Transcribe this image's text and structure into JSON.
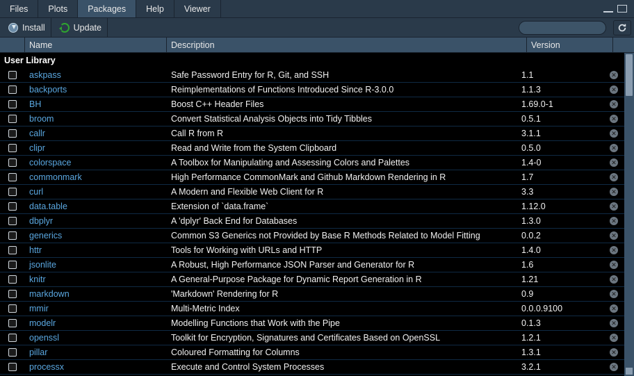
{
  "tabs": [
    {
      "label": "Files",
      "active": false
    },
    {
      "label": "Plots",
      "active": false
    },
    {
      "label": "Packages",
      "active": true
    },
    {
      "label": "Help",
      "active": false
    },
    {
      "label": "Viewer",
      "active": false
    }
  ],
  "toolbar": {
    "install_label": "Install",
    "update_label": "Update",
    "search_placeholder": ""
  },
  "columns": {
    "name": "Name",
    "description": "Description",
    "version": "Version"
  },
  "section_title": "User Library",
  "packages": [
    {
      "name": "askpass",
      "desc": "Safe Password Entry for R, Git, and SSH",
      "version": "1.1"
    },
    {
      "name": "backports",
      "desc": "Reimplementations of Functions Introduced Since R-3.0.0",
      "version": "1.1.3"
    },
    {
      "name": "BH",
      "desc": "Boost C++ Header Files",
      "version": "1.69.0-1"
    },
    {
      "name": "broom",
      "desc": "Convert Statistical Analysis Objects into Tidy Tibbles",
      "version": "0.5.1"
    },
    {
      "name": "callr",
      "desc": "Call R from R",
      "version": "3.1.1"
    },
    {
      "name": "clipr",
      "desc": "Read and Write from the System Clipboard",
      "version": "0.5.0"
    },
    {
      "name": "colorspace",
      "desc": "A Toolbox for Manipulating and Assessing Colors and Palettes",
      "version": "1.4-0"
    },
    {
      "name": "commonmark",
      "desc": "High Performance CommonMark and Github Markdown Rendering in R",
      "version": "1.7"
    },
    {
      "name": "curl",
      "desc": "A Modern and Flexible Web Client for R",
      "version": "3.3"
    },
    {
      "name": "data.table",
      "desc": "Extension of `data.frame`",
      "version": "1.12.0"
    },
    {
      "name": "dbplyr",
      "desc": "A 'dplyr' Back End for Databases",
      "version": "1.3.0"
    },
    {
      "name": "generics",
      "desc": "Common S3 Generics not Provided by Base R Methods Related to Model Fitting",
      "version": "0.0.2"
    },
    {
      "name": "httr",
      "desc": "Tools for Working with URLs and HTTP",
      "version": "1.4.0"
    },
    {
      "name": "jsonlite",
      "desc": "A Robust, High Performance JSON Parser and Generator for R",
      "version": "1.6"
    },
    {
      "name": "knitr",
      "desc": "A General-Purpose Package for Dynamic Report Generation in R",
      "version": "1.21"
    },
    {
      "name": "markdown",
      "desc": "'Markdown' Rendering for R",
      "version": "0.9"
    },
    {
      "name": "mmir",
      "desc": "Multi-Metric Index",
      "version": "0.0.0.9100"
    },
    {
      "name": "modelr",
      "desc": "Modelling Functions that Work with the Pipe",
      "version": "0.1.3"
    },
    {
      "name": "openssl",
      "desc": "Toolkit for Encryption, Signatures and Certificates Based on OpenSSL",
      "version": "1.2.1"
    },
    {
      "name": "pillar",
      "desc": "Coloured Formatting for Columns",
      "version": "1.3.1"
    },
    {
      "name": "processx",
      "desc": "Execute and Control System Processes",
      "version": "3.2.1"
    }
  ]
}
